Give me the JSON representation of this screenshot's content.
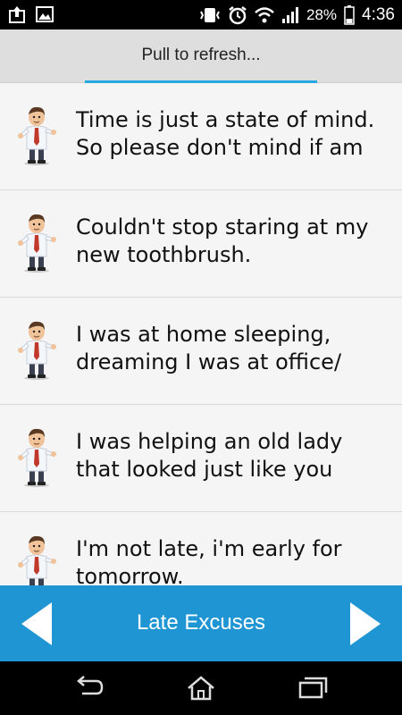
{
  "status_bar": {
    "battery_text": "28%",
    "time": "4:36"
  },
  "refresh": {
    "label": "Pull to refresh..."
  },
  "excuses": [
    {
      "text": "Time is just a state of mind. So please don't mind if am"
    },
    {
      "text": "Couldn't stop staring at my new toothbrush."
    },
    {
      "text": "I was at home sleeping, dreaming I was at office/"
    },
    {
      "text": "I was helping an old lady that looked just like you"
    },
    {
      "text": "I'm not late, i'm early for tomorrow."
    }
  ],
  "bottom_bar": {
    "title": "Late Excuses"
  },
  "colors": {
    "accent": "#1f95d4",
    "refresh_indicator": "#29a9e1"
  }
}
